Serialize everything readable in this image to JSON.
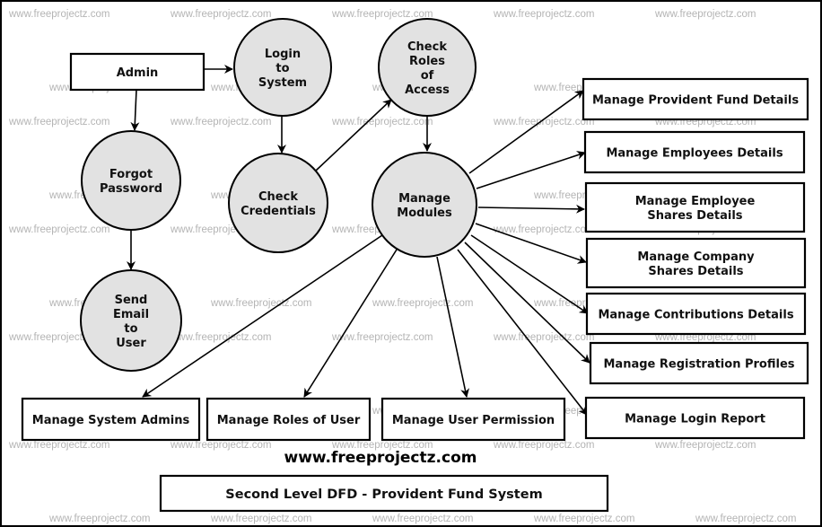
{
  "diagram": {
    "title": "Second Level DFD - Provident Fund System",
    "site_label": "www.freeprojectz.com",
    "watermark": "www.freeprojectz.com",
    "colors": {
      "process_fill": "#e2e2e2",
      "stroke": "#000000",
      "watermark": "#b4b4b4"
    },
    "entities": [
      {
        "id": "admin",
        "lines": [
          "Admin"
        ]
      },
      {
        "id": "manage-provident-fund-details",
        "lines": [
          "Manage Provident Fund Details"
        ]
      },
      {
        "id": "manage-employees-details",
        "lines": [
          "Manage Employees Details"
        ]
      },
      {
        "id": "manage-employee-shares-details",
        "lines": [
          "Manage Employee",
          "Shares Details"
        ]
      },
      {
        "id": "manage-company-shares-details",
        "lines": [
          "Manage Company",
          "Shares Details"
        ]
      },
      {
        "id": "manage-contributions-details",
        "lines": [
          "Manage Contributions Details"
        ]
      },
      {
        "id": "manage-registration-profiles",
        "lines": [
          "Manage Registration Profiles"
        ]
      },
      {
        "id": "manage-login-report",
        "lines": [
          "Manage Login Report"
        ]
      },
      {
        "id": "manage-system-admins",
        "lines": [
          "Manage System Admins"
        ]
      },
      {
        "id": "manage-roles-of-user",
        "lines": [
          "Manage Roles of User"
        ]
      },
      {
        "id": "manage-user-permission",
        "lines": [
          "Manage User Permission"
        ]
      }
    ],
    "processes": [
      {
        "id": "login-to-system",
        "lines": [
          "Login",
          "to",
          "System"
        ]
      },
      {
        "id": "check-roles-of-access",
        "lines": [
          "Check",
          "Roles",
          "of",
          "Access"
        ]
      },
      {
        "id": "forgot-password",
        "lines": [
          "Forgot",
          "Password"
        ]
      },
      {
        "id": "check-credentials",
        "lines": [
          "Check",
          "Credentials"
        ]
      },
      {
        "id": "manage-modules",
        "lines": [
          "Manage",
          "Modules"
        ]
      },
      {
        "id": "send-email-to-user",
        "lines": [
          "Send",
          "Email",
          "to",
          "User"
        ]
      }
    ],
    "flows": [
      {
        "from": "admin",
        "to": "login-to-system"
      },
      {
        "from": "admin",
        "to": "forgot-password"
      },
      {
        "from": "login-to-system",
        "to": "check-credentials"
      },
      {
        "from": "check-credentials",
        "to": "check-roles-of-access"
      },
      {
        "from": "check-roles-of-access",
        "to": "manage-modules"
      },
      {
        "from": "forgot-password",
        "to": "send-email-to-user"
      },
      {
        "from": "manage-modules",
        "to": "manage-provident-fund-details"
      },
      {
        "from": "manage-modules",
        "to": "manage-employees-details"
      },
      {
        "from": "manage-modules",
        "to": "manage-employee-shares-details"
      },
      {
        "from": "manage-modules",
        "to": "manage-company-shares-details"
      },
      {
        "from": "manage-modules",
        "to": "manage-contributions-details"
      },
      {
        "from": "manage-modules",
        "to": "manage-registration-profiles"
      },
      {
        "from": "manage-modules",
        "to": "manage-login-report"
      },
      {
        "from": "manage-modules",
        "to": "manage-system-admins"
      },
      {
        "from": "manage-modules",
        "to": "manage-roles-of-user"
      },
      {
        "from": "manage-modules",
        "to": "manage-user-permission"
      }
    ]
  }
}
